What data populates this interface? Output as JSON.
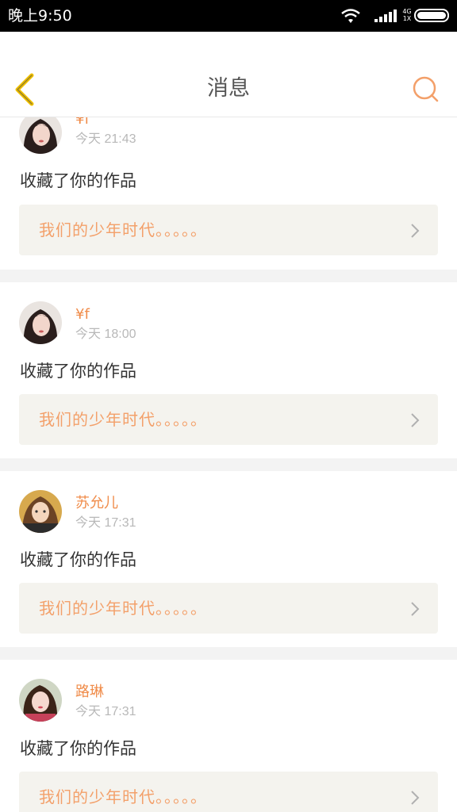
{
  "status_bar": {
    "time": "晚上9:50",
    "network": "4G",
    "network_sub": "1X"
  },
  "nav": {
    "title": "消息",
    "back_icon": "chevron-left-icon",
    "search_icon": "search-icon"
  },
  "messages": [
    {
      "user": "¥f",
      "time": "今天 21:43",
      "action": "收藏了你的作品",
      "work": "我们的少年时代。。。。。"
    },
    {
      "user": "¥f",
      "time": "今天 18:00",
      "action": "收藏了你的作品",
      "work": "我们的少年时代。。。。。"
    },
    {
      "user": "苏允儿",
      "time": "今天 17:31",
      "action": "收藏了你的作品",
      "work": "我们的少年时代。。。。。"
    },
    {
      "user": "路琳",
      "time": "今天 17:31",
      "action": "收藏了你的作品",
      "work": "我们的少年时代。。。。。"
    }
  ],
  "colors": {
    "accent": "#f08c4a",
    "back_icon": "#f0c000",
    "card_box": "#f4f3ee"
  }
}
